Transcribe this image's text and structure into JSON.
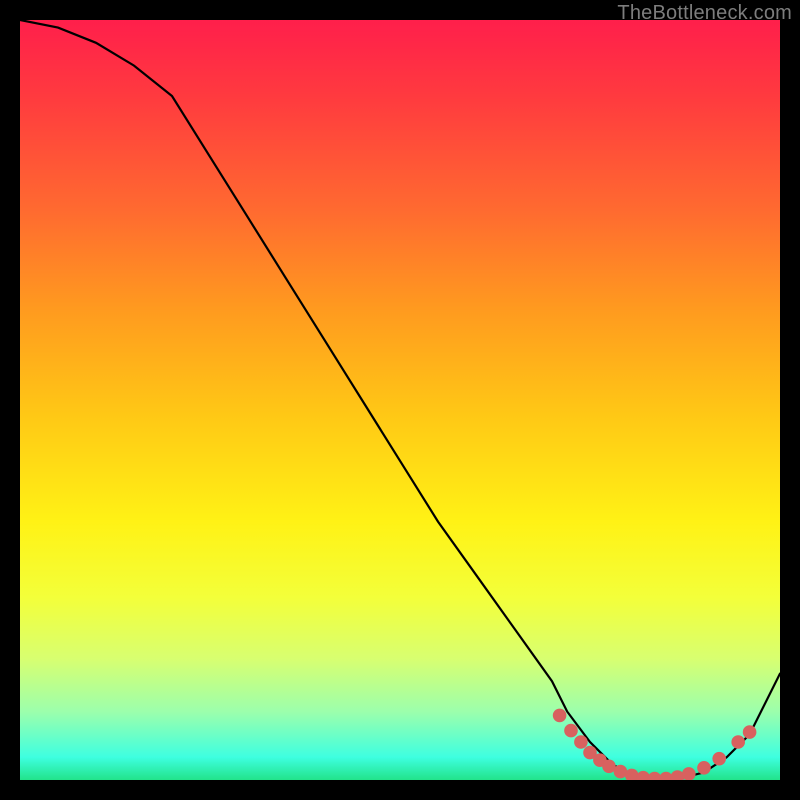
{
  "watermark": "TheBottleneck.com",
  "chart_data": {
    "type": "line",
    "title": "",
    "xlabel": "",
    "ylabel": "",
    "xlim": [
      0,
      100
    ],
    "ylim": [
      0,
      100
    ],
    "grid": false,
    "series": [
      {
        "name": "curve",
        "color": "#000000",
        "x": [
          0,
          5,
          10,
          15,
          20,
          25,
          30,
          35,
          40,
          45,
          50,
          55,
          60,
          65,
          70,
          72,
          75,
          78,
          82,
          86,
          90,
          93,
          96,
          100
        ],
        "y": [
          100,
          99,
          97,
          94,
          90,
          82,
          74,
          66,
          58,
          50,
          42,
          34,
          27,
          20,
          13,
          9,
          5,
          2,
          0,
          0,
          1,
          3,
          6,
          14
        ]
      }
    ],
    "markers": {
      "name": "dots",
      "color": "#d8615f",
      "radius_pct": 0.9,
      "points": [
        {
          "x": 71.0,
          "y": 8.5
        },
        {
          "x": 72.5,
          "y": 6.5
        },
        {
          "x": 73.8,
          "y": 5.0
        },
        {
          "x": 75.0,
          "y": 3.6
        },
        {
          "x": 76.3,
          "y": 2.6
        },
        {
          "x": 77.5,
          "y": 1.8
        },
        {
          "x": 79.0,
          "y": 1.1
        },
        {
          "x": 80.5,
          "y": 0.6
        },
        {
          "x": 82.0,
          "y": 0.3
        },
        {
          "x": 83.5,
          "y": 0.2
        },
        {
          "x": 85.0,
          "y": 0.2
        },
        {
          "x": 86.5,
          "y": 0.4
        },
        {
          "x": 88.0,
          "y": 0.8
        },
        {
          "x": 90.0,
          "y": 1.6
        },
        {
          "x": 92.0,
          "y": 2.8
        },
        {
          "x": 94.5,
          "y": 5.0
        },
        {
          "x": 96.0,
          "y": 6.3
        }
      ]
    }
  }
}
